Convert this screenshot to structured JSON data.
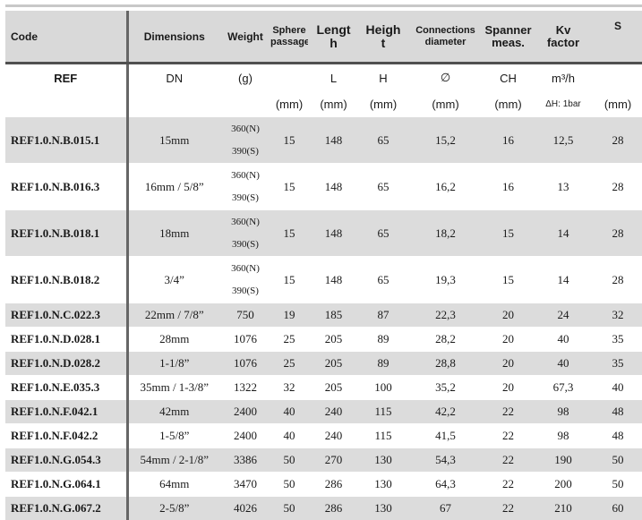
{
  "headers": {
    "code": "Code",
    "dimensions": "Dimensions",
    "weight": "Weight",
    "sphere_1": "Sphere",
    "sphere_2": "passage",
    "length_1": "Lengt",
    "length_2": "h",
    "height_1": "Heigh",
    "height_2": "t",
    "conn_1": "Connections",
    "conn_2": "diameter",
    "spanner_1": "Spanner",
    "spanner_2": "meas.",
    "kv_1": "Kv",
    "kv_2": "factor",
    "s": "S"
  },
  "symbols": {
    "ref": "REF",
    "dn": "DN",
    "g": "(g)",
    "l": "L",
    "h": "H",
    "dia": "∅",
    "ch": "CH",
    "m3h": "m³/h"
  },
  "units": {
    "sphere": "(mm)",
    "length": "(mm)",
    "height": "(mm)",
    "conn": "(mm)",
    "spanner": "(mm)",
    "kv": "ΔH: 1bar",
    "s": "(mm)"
  },
  "rows": [
    {
      "code": "REF1.0.N.B.015.1",
      "dim": "15mm",
      "weight": "",
      "w1": "360(N)",
      "w2": "390(S)",
      "sphere": "15",
      "length": "148",
      "height": "65",
      "conn": "15,2",
      "spanner": "16",
      "kv": "12,5",
      "s": "28"
    },
    {
      "code": "REF1.0.N.B.016.3",
      "dim": "16mm / 5/8”",
      "weight": "",
      "w1": "360(N)",
      "w2": "390(S)",
      "sphere": "15",
      "length": "148",
      "height": "65",
      "conn": "16,2",
      "spanner": "16",
      "kv": "13",
      "s": "28"
    },
    {
      "code": "REF1.0.N.B.018.1",
      "dim": "18mm",
      "weight": "",
      "w1": "360(N)",
      "w2": "390(S)",
      "sphere": "15",
      "length": "148",
      "height": "65",
      "conn": "18,2",
      "spanner": "15",
      "kv": "14",
      "s": "28"
    },
    {
      "code": "REF1.0.N.B.018.2",
      "dim": "3/4”",
      "weight": "",
      "w1": "360(N)",
      "w2": "390(S)",
      "sphere": "15",
      "length": "148",
      "height": "65",
      "conn": "19,3",
      "spanner": "15",
      "kv": "14",
      "s": "28"
    },
    {
      "code": "REF1.0.N.C.022.3",
      "dim": "22mm / 7/8”",
      "weight": "750",
      "sphere": "19",
      "length": "185",
      "height": "87",
      "conn": "22,3",
      "spanner": "20",
      "kv": "24",
      "s": "32"
    },
    {
      "code": "REF1.0.N.D.028.1",
      "dim": "28mm",
      "weight": "1076",
      "sphere": "25",
      "length": "205",
      "height": "89",
      "conn": "28,2",
      "spanner": "20",
      "kv": "40",
      "s": "35"
    },
    {
      "code": "REF1.0.N.D.028.2",
      "dim": "1-1/8”",
      "weight": "1076",
      "sphere": "25",
      "length": "205",
      "height": "89",
      "conn": "28,8",
      "spanner": "20",
      "kv": "40",
      "s": "35"
    },
    {
      "code": "REF1.0.N.E.035.3",
      "dim": "35mm / 1-3/8”",
      "weight": "1322",
      "sphere": "32",
      "length": "205",
      "height": "100",
      "conn": "35,2",
      "spanner": "20",
      "kv": "67,3",
      "s": "40"
    },
    {
      "code": "REF1.0.N.F.042.1",
      "dim": "42mm",
      "weight": "2400",
      "sphere": "40",
      "length": "240",
      "height": "115",
      "conn": "42,2",
      "spanner": "22",
      "kv": "98",
      "s": "48"
    },
    {
      "code": "REF1.0.N.F.042.2",
      "dim": "1-5/8”",
      "weight": "2400",
      "sphere": "40",
      "length": "240",
      "height": "115",
      "conn": "41,5",
      "spanner": "22",
      "kv": "98",
      "s": "48"
    },
    {
      "code": "REF1.0.N.G.054.3",
      "dim": "54mm / 2-1/8”",
      "weight": "3386",
      "sphere": "50",
      "length": "270",
      "height": "130",
      "conn": "54,3",
      "spanner": "22",
      "kv": "190",
      "s": "50"
    },
    {
      "code": "REF1.0.N.G.064.1",
      "dim": "64mm",
      "weight": "3470",
      "sphere": "50",
      "length": "286",
      "height": "130",
      "conn": "64,3",
      "spanner": "22",
      "kv": "200",
      "s": "50"
    },
    {
      "code": "REF1.0.N.G.067.2",
      "dim": "2-5/8”",
      "weight": "4026",
      "sphere": "50",
      "length": "286",
      "height": "130",
      "conn": "67",
      "spanner": "22",
      "kv": "210",
      "s": "60"
    }
  ]
}
